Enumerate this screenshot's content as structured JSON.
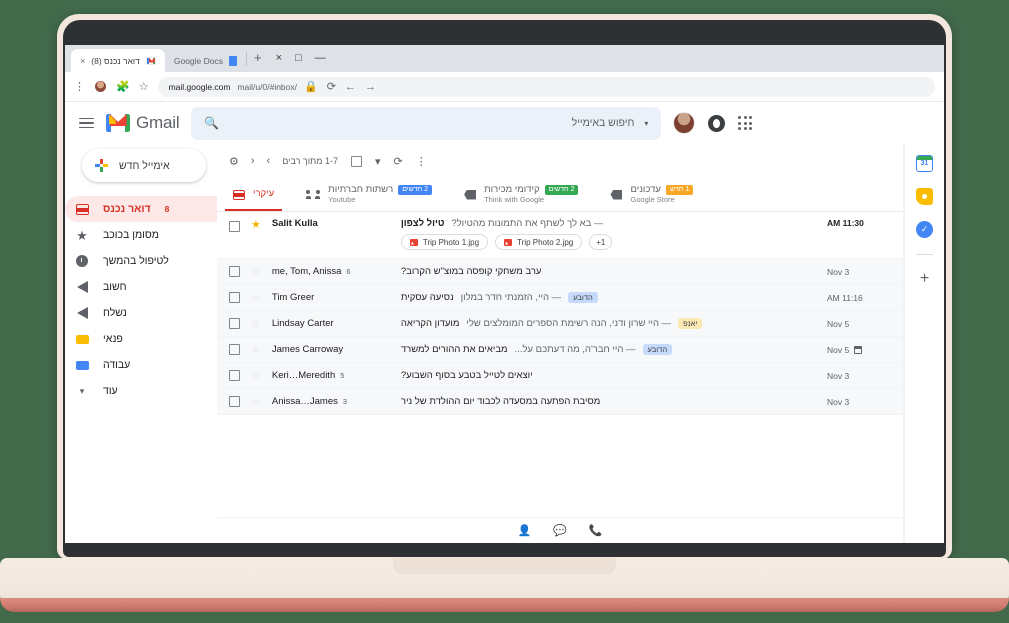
{
  "browser": {
    "window_controls": [
      "×",
      "□",
      "—"
    ],
    "tabs": [
      {
        "title": "דואר נכנס (8)",
        "favicon": "gmail-favicon",
        "active": true
      },
      {
        "title": "Google Docs",
        "favicon": "google-docs-favicon",
        "active": false
      }
    ],
    "new_tab_label": "+",
    "tab_close_label": "×",
    "omnibox": {
      "url_bold": "mail.google.com",
      "url_dim": "/mail/u/0/#inbox",
      "lock": "🔒"
    },
    "toolbar_icons": {
      "reload": "⟳",
      "back": "←",
      "forward": "→",
      "menu": "⋮",
      "extensions": "🧩",
      "bookmark": "☆"
    }
  },
  "gmail": {
    "logo_text": "Gmail",
    "search": {
      "placeholder": "חיפוש באימייל",
      "icon": "search-icon",
      "caret": "▾"
    },
    "header_icons": {
      "hamburger": "menu-icon",
      "apps": "apps-grid-icon",
      "assistant": "assistant-icon",
      "avatar": "user-avatar"
    },
    "compose": {
      "label": "אימייל חדש"
    },
    "nav_items": [
      {
        "label": "דואר נכנס",
        "icon": "inbox-icon",
        "count": "8",
        "active": true
      },
      {
        "label": "מסומן בכוכב",
        "icon": "star-icon",
        "count": "",
        "active": false
      },
      {
        "label": "לטיפול בהמשך",
        "icon": "snooze-clock-icon",
        "count": "",
        "active": false
      },
      {
        "label": "חשוב",
        "icon": "important-icon",
        "count": "",
        "active": false
      },
      {
        "label": "נשלח",
        "icon": "sent-icon",
        "count": "",
        "active": false
      },
      {
        "label": "פנאי",
        "icon": "label-yellow-icon",
        "count": "",
        "active": false
      },
      {
        "label": "עבודה",
        "icon": "label-blue-icon",
        "count": "",
        "active": false
      },
      {
        "label": "עוד",
        "icon": "chevron-down-icon",
        "count": "",
        "active": false
      }
    ],
    "toolbar": {
      "pager": "1-7 מתוך רבים",
      "select_all": "select-all-checkbox",
      "settings": "⚙",
      "prev": "‹",
      "next": "›",
      "refresh": "⟳",
      "more": "⋮",
      "caret": "▾"
    },
    "category_tabs": [
      {
        "name": "עיקרי",
        "sub": "",
        "badge": "",
        "badge_color": "",
        "icon": "inbox-icon",
        "active": true
      },
      {
        "name": "רשתות חברתיות",
        "sub": "Youtube",
        "badge": "2 חדשים",
        "badge_color": "#4285f4",
        "icon": "people-icon",
        "active": false
      },
      {
        "name": "קידומי מכירות",
        "sub": "Think with Google",
        "badge": "2 חדשים",
        "badge_color": "#34a853",
        "icon": "tag-icon",
        "active": false
      },
      {
        "name": "עדכונים",
        "sub": "Google Store",
        "badge": "1 חדש",
        "badge_color": "#f9a825",
        "icon": "tag-icon",
        "active": false
      }
    ],
    "emails": [
      {
        "sender": "Salit Kulla",
        "count": "",
        "starred": true,
        "unread": true,
        "subject": "טיול לצפון",
        "snippet": "— בא לך לשתף את התמונות מהטיול?",
        "label": "",
        "label_color": "",
        "date": "11:30 AM",
        "has_calendar": false,
        "attachments": [
          {
            "name": "Trip Photo 1.jpg",
            "type": "image"
          },
          {
            "name": "Trip Photo 2.jpg",
            "type": "image"
          },
          {
            "name": "1+",
            "type": "more"
          }
        ]
      },
      {
        "sender": "me, Tom, Anissa",
        "count": "6",
        "starred": false,
        "unread": false,
        "subject": "ערב משחקי קופסה במוצ\"ש הקרוב?",
        "snippet": "",
        "label": "",
        "label_color": "",
        "date": "Nov 3",
        "has_calendar": false,
        "attachments": []
      },
      {
        "sender": "Tim Greer",
        "count": "",
        "starred": false,
        "unread": false,
        "subject": "נסיעה עסקית",
        "snippet": "— היי, הזמנתי חדר במלון",
        "label": "הדובע",
        "label_color": "blue",
        "date": "11:16 AM",
        "has_calendar": false,
        "attachments": []
      },
      {
        "sender": "Lindsay Carter",
        "count": "",
        "starred": false,
        "unread": false,
        "subject": "מועדון הקריאה",
        "snippet": "— היי שרון ודני, הנה רשימת הספרים המומלצים שלי",
        "label": "יאנפ",
        "label_color": "orange",
        "date": "Nov 5",
        "has_calendar": false,
        "attachments": []
      },
      {
        "sender": "James Carroway",
        "count": "",
        "starred": false,
        "unread": false,
        "subject": "מביאים את ההורים למשרד",
        "snippet": "— היי חבר'ה, מה דעתכם על...",
        "label": "הדובע",
        "label_color": "blue",
        "date": "Nov 5",
        "has_calendar": true,
        "attachments": []
      },
      {
        "sender": "Keri…Meredith",
        "count": "5",
        "starred": false,
        "unread": false,
        "subject": "יוצאים לטייל בטבע בסוף השבוע?",
        "snippet": "",
        "label": "",
        "label_color": "",
        "date": "Nov 3",
        "has_calendar": false,
        "attachments": []
      },
      {
        "sender": "Anissa…James",
        "count": "3",
        "starred": false,
        "unread": false,
        "subject": "מסיבת הפתעה במסעדה לכבוד יום ההולדת של ניר",
        "snippet": "",
        "label": "",
        "label_color": "",
        "date": "Nov 3",
        "has_calendar": false,
        "attachments": []
      }
    ],
    "rail": {
      "calendar": "31",
      "keep_icon": "keep-icon",
      "tasks_icon": "tasks-icon",
      "add_label": "+"
    },
    "chatbar": {
      "contacts": "contacts-icon",
      "chat": "chat-icon",
      "phone": "phone-icon"
    }
  }
}
